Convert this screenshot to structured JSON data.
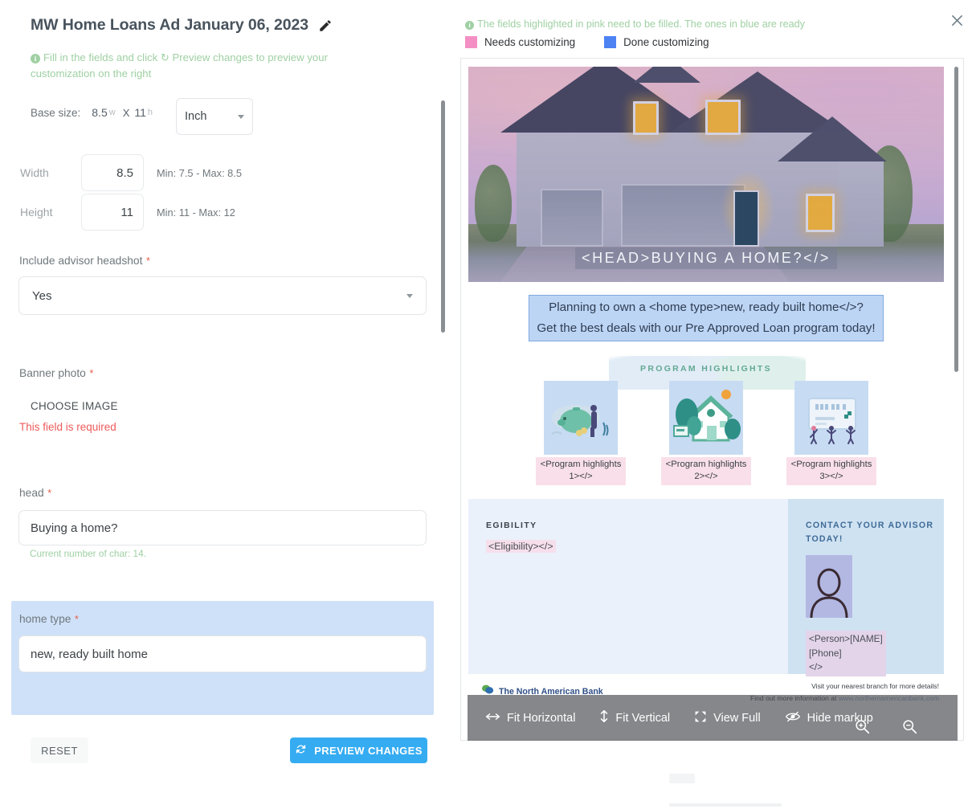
{
  "form": {
    "title": "MW Home Loans Ad January 06, 2023",
    "edit_icon": "pencil-icon",
    "hint": "Fill in the fields and click",
    "hint_action": "Preview changes",
    "hint_tail": "to preview your customization on the right",
    "base_size": {
      "label": "Base size:",
      "width": "8.5",
      "width_unit": "w",
      "times": "X",
      "height": "11",
      "height_unit": "h",
      "unit_value": "Inch"
    },
    "width_field": {
      "label": "Width",
      "value": "8.5",
      "minmax": "Min: 7.5 - Max: 8.5"
    },
    "height_field": {
      "label": "Height",
      "value": "11",
      "minmax": "Min: 11 - Max: 12"
    },
    "headshot": {
      "label": "Include advisor headshot",
      "required_mark": "*",
      "value": "Yes"
    },
    "banner_photo": {
      "label": "Banner photo",
      "required_mark": "*",
      "button": "CHOOSE IMAGE",
      "error": "This field is required"
    },
    "head": {
      "label": "head",
      "required_mark": "*",
      "value": "Buying a home?",
      "char_count": "Current number of char: 14."
    },
    "home_type": {
      "label": "home type",
      "required_mark": "*",
      "value": "new, ready built home"
    },
    "reset_button": "RESET",
    "preview_button": "PREVIEW CHANGES"
  },
  "preview": {
    "note": "The fields highlighted in pink need to be filled. The ones in blue are ready",
    "legend": [
      {
        "label": "Needs customizing",
        "color": "#f48fc4"
      },
      {
        "label": "Done customizing",
        "color": "#4d82f3"
      }
    ],
    "close_label": "✕",
    "toolbar": [
      {
        "label": "Fit Horizontal",
        "icon": "arrows-horizontal-icon"
      },
      {
        "label": "Fit Vertical",
        "icon": "arrows-vertical-icon"
      },
      {
        "label": "View Full",
        "icon": "expand-icon"
      },
      {
        "label": "Hide markup",
        "icon": "eye-slash-icon"
      }
    ],
    "zoom_in": "zoom-in-icon",
    "zoom_out": "zoom-out-icon"
  },
  "document": {
    "banner_head": "<HEAD>BUYING A HOME?</>",
    "subhead_line1": "Planning to own a <home type>new, ready built home</>?",
    "subhead_line2": "Get the best deals with our Pre Approved Loan program today!",
    "highlights_title": "PROGRAM HIGHLIGHTS",
    "highlights": [
      {
        "caption": "<Program highlights 1></>"
      },
      {
        "caption": "<Program highlights 2></>"
      },
      {
        "caption": "<Program highlights 3></>"
      }
    ],
    "eligibility_title": "EGIBILITY",
    "eligibility_value": "<Eligibility></>",
    "advisor_title": "CONTACT YOUR ADVISOR TODAY!",
    "advisor_info_line1": "<Person>[NAME]",
    "advisor_info_line2": "[Phone]",
    "advisor_info_line3": "</>",
    "bank_name": "The North American Bank",
    "footer_line1": "Visit your nearest branch for more details!",
    "footer_line2_prefix": "Find out more information at ",
    "footer_url": "www.northernamericanbank.com"
  },
  "colors": {
    "accent_blue": "#35acf2",
    "hint_green": "#9fd0a3",
    "error_red": "#ef5a5a",
    "pink_highlight": "#f9dfe9",
    "blue_highlight": "#cfe1f8"
  }
}
